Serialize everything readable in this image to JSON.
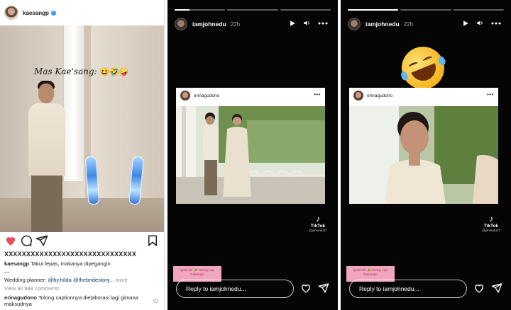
{
  "post": {
    "username": "kaesangp",
    "overlay_text": "Mas Kae'sang:",
    "overlay_emojis": "😆🤣🤪",
    "caption_line1": "XXXXXXXXXXXXXXXXXXXXXXXXXXXXXX",
    "caption_user": "kaesangp",
    "caption_text": "Takut lepas, makanya dipegangin",
    "caption_dash": "—",
    "planner_label": "Wedding planner:",
    "planner_link1": "@by.hilda",
    "planner_link2": "@thebridestory...",
    "more": "more",
    "view_comments": "View all 988 comments",
    "comment_user": "erinagudono",
    "comment_text": "Tolong captionnya dielaborasi lagi gimana maksudnya"
  },
  "story1": {
    "username": "iamjohnedu",
    "time": "22h",
    "progress": [
      0.3,
      0,
      0
    ],
    "card_user": "erinagudono",
    "tiktok_label": "TikTok",
    "tiktok_handle": "@johnedu27",
    "reply_placeholder": "Reply to iamjohnedu..."
  },
  "story2": {
    "username": "iamjohnedu",
    "time": "22h",
    "progress": [
      1,
      0,
      0
    ],
    "card_user": "erinagudono",
    "tiktok_label": "TikTok",
    "tiktok_handle": "@johnedu27",
    "reply_placeholder": "Reply to iamjohnedu..."
  },
  "sticker_text": "*gokil sih 🤣 Tolong cap-Pasangin",
  "colors": {
    "like_red": "#ed4956",
    "link_blue": "#00376b",
    "story_bg": "#050505",
    "sticker_pink": "#f1a6bf"
  },
  "icons": [
    "heart-icon",
    "comment-icon",
    "share-icon",
    "bookmark-icon",
    "play-icon",
    "volume-icon",
    "more-icon",
    "send-icon",
    "verified-icon"
  ]
}
